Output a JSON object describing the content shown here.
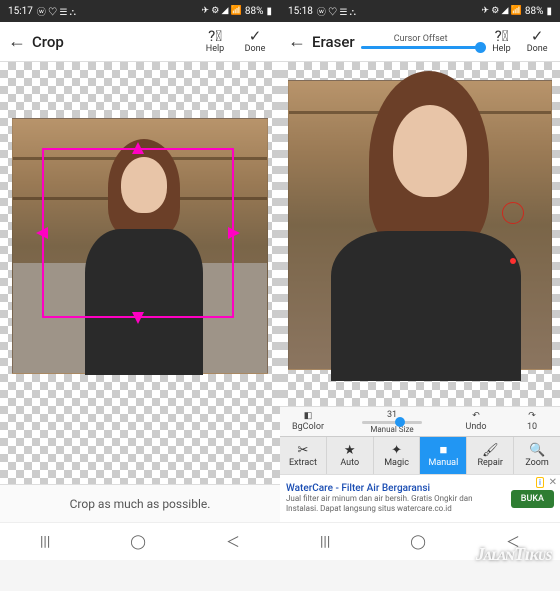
{
  "status": {
    "time_left": "15:17",
    "time_right": "15:18",
    "battery": "88%",
    "icons_left": "ⓦ ♡ ☰ ⛬",
    "icons_right": "✈ ⚙ ◢ 📶"
  },
  "left": {
    "title": "Crop",
    "help": "Help",
    "done": "Done",
    "message": "Crop as much as possible."
  },
  "right": {
    "title": "Eraser",
    "cursor_offset": "Cursor Offset",
    "help": "Help",
    "done": "Done",
    "toolrow": {
      "bgcolor": "BgColor",
      "manual_size_label": "Manual Size",
      "manual_size_value": "31",
      "undo": "Undo",
      "redo_value": "10"
    },
    "tabs": {
      "extract": "Extract",
      "auto": "Auto",
      "magic": "Magic",
      "manual": "Manual",
      "repair": "Repair",
      "zoom": "Zoom"
    },
    "ad": {
      "title": "WaterCare - Filter Air Bergaransi",
      "desc": "Jual filter air minum dan air bersih. Gratis Ongkir dan Instalasi. Dapat langsung situs watercare.co.id",
      "cta": "BUKA",
      "info": "i"
    }
  },
  "watermark": "JᴀʟᴀɴTɪᴋᴜs"
}
